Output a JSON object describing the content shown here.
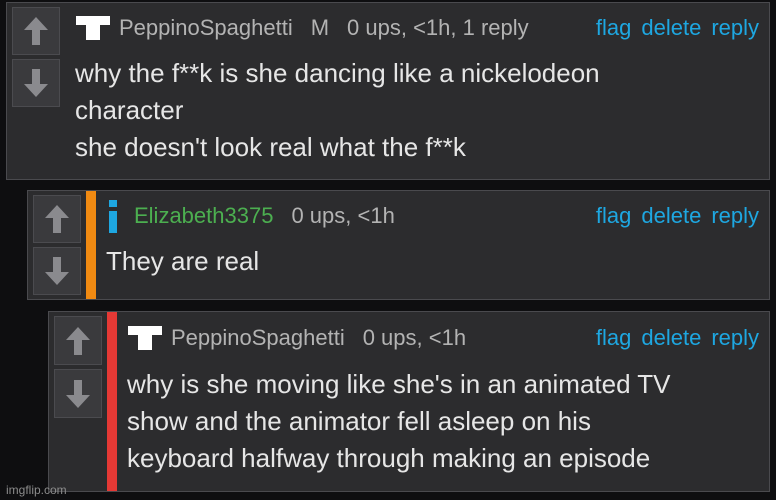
{
  "comments": [
    {
      "user": "PeppinoSpaghetti",
      "badge": "M",
      "stats": "0 ups, <1h, 1 reply",
      "text": "why the f**k is she dancing like a nickelodeon\ncharacter\nshe doesn't look real what the f**k",
      "user_color": "#b3b3b3"
    },
    {
      "user": "Elizabeth3375",
      "stats": "0 ups, <1h",
      "text": "They are real",
      "user_color": "#4caf50",
      "stripe_color": "#f08a12"
    },
    {
      "user": "PeppinoSpaghetti",
      "stats": "0 ups, <1h",
      "text": "why is she moving like she's in an animated TV\nshow and the animator fell asleep on his\nkeyboard halfway through making an episode",
      "user_color": "#b3b3b3",
      "stripe_color": "#e53935"
    }
  ],
  "actions": {
    "flag": "flag",
    "delete": "delete",
    "reply": "reply"
  },
  "watermark": "imgflip.com",
  "icons": [
    "upvote-icon",
    "downvote-icon",
    "user-avatar-icon",
    "info-icon"
  ]
}
